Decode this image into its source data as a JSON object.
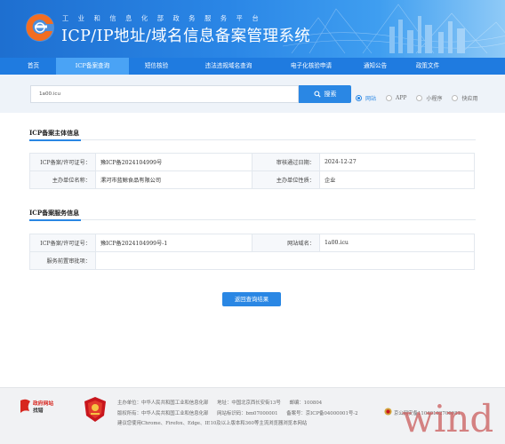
{
  "header": {
    "subtitle": "工业和信息化部政务服务平台",
    "title": "ICP/IP地址/域名信息备案管理系统",
    "colors": {
      "primary": "#1f7be0",
      "accent": "#2a87e4",
      "logo_orange": "#f26d21"
    }
  },
  "nav": {
    "items": [
      {
        "label": "首页",
        "active": false
      },
      {
        "label": "ICP备案查询",
        "active": true
      },
      {
        "label": "短信核验",
        "active": false
      },
      {
        "label": "违法违规域名查询",
        "active": false
      },
      {
        "label": "电子化核验申请",
        "active": false
      },
      {
        "label": "通知公告",
        "active": false
      },
      {
        "label": "政策文件",
        "active": false
      }
    ]
  },
  "search": {
    "value": "1a00.icu",
    "button_label": "搜索",
    "button_icon": "search-icon",
    "types": [
      {
        "label": "网站",
        "checked": true
      },
      {
        "label": "APP",
        "checked": false
      },
      {
        "label": "小程序",
        "checked": false
      },
      {
        "label": "快应用",
        "checked": false
      }
    ]
  },
  "subject": {
    "title": "ICP备案主体信息",
    "rows": [
      [
        "ICP备案/许可证号：",
        "豫ICP备2024104999号",
        "审核通过日期：",
        "2024-12-27"
      ],
      [
        "主办单位名称：",
        "漯河市蓝鲸食品有限公司",
        "主办单位性质：",
        "企业"
      ]
    ]
  },
  "service": {
    "title": "ICP备案服务信息",
    "rows": [
      [
        "ICP备案/许可证号：",
        "豫ICP备2024104999号-1",
        "网站域名：",
        "1a00.icu"
      ],
      [
        "服务前置审批项：",
        "",
        "",
        ""
      ]
    ]
  },
  "return_label": "返回查询结果",
  "footer": {
    "gov_badge_top": "政府网站",
    "gov_badge_bottom": "找错",
    "sponsor": "主办单位：中华人民共和国工业和信息化部",
    "address": "地址：中国北京西长安街13号",
    "postcode": "邮编：100804",
    "copyright": "版权所有：中华人民共和国工业和信息化部",
    "site_code": "网站标识码：bm07000001",
    "icp": "备案号：京ICP备04000001号-2",
    "police": "京公网安备11040102700081",
    "browser_tip": "建议您使用Chrome、Firefox、Edge、IE10及以上版本和360等主流浏览器浏览本网站"
  },
  "watermark": "wind"
}
